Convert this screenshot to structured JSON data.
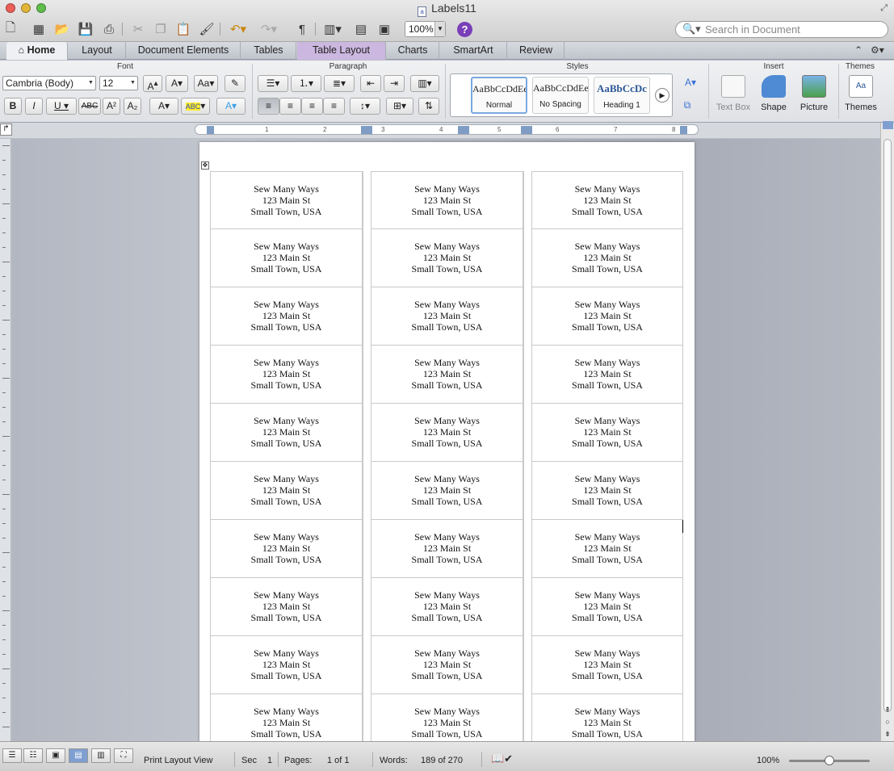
{
  "window": {
    "title": "Labels11"
  },
  "toolbar": {
    "zoom": "100%",
    "search_placeholder": "Search in Document"
  },
  "tabs": [
    "Home",
    "Layout",
    "Document Elements",
    "Tables",
    "Table Layout",
    "Charts",
    "SmartArt",
    "Review"
  ],
  "ribbon": {
    "groups": {
      "font": "Font",
      "paragraph": "Paragraph",
      "styles": "Styles",
      "insert": "Insert",
      "themes": "Themes"
    },
    "font_name": "Cambria (Body)",
    "font_size": "12",
    "styles": [
      {
        "sample": "AaBbCcDdEe",
        "name": "Normal"
      },
      {
        "sample": "AaBbCcDdEe",
        "name": "No Spacing"
      },
      {
        "sample": "AaBbCcDc",
        "name": "Heading 1"
      }
    ],
    "insert_buttons": [
      "Text Box",
      "Shape",
      "Picture"
    ],
    "themes_button": "Themes"
  },
  "ruler": {
    "numbers": [
      "1",
      "2",
      "3",
      "4",
      "5",
      "6",
      "7",
      "8"
    ]
  },
  "document": {
    "label": {
      "line1": "Sew Many Ways",
      "line2": "123 Main St",
      "line3": "Small Town, USA"
    },
    "rows_visible": 10,
    "columns": 3
  },
  "status": {
    "view": "Print Layout View",
    "sec_label": "Sec",
    "sec_value": "1",
    "pages_label": "Pages:",
    "pages_value": "1 of 1",
    "words_label": "Words:",
    "words_value": "189 of 270",
    "zoom": "100%"
  }
}
